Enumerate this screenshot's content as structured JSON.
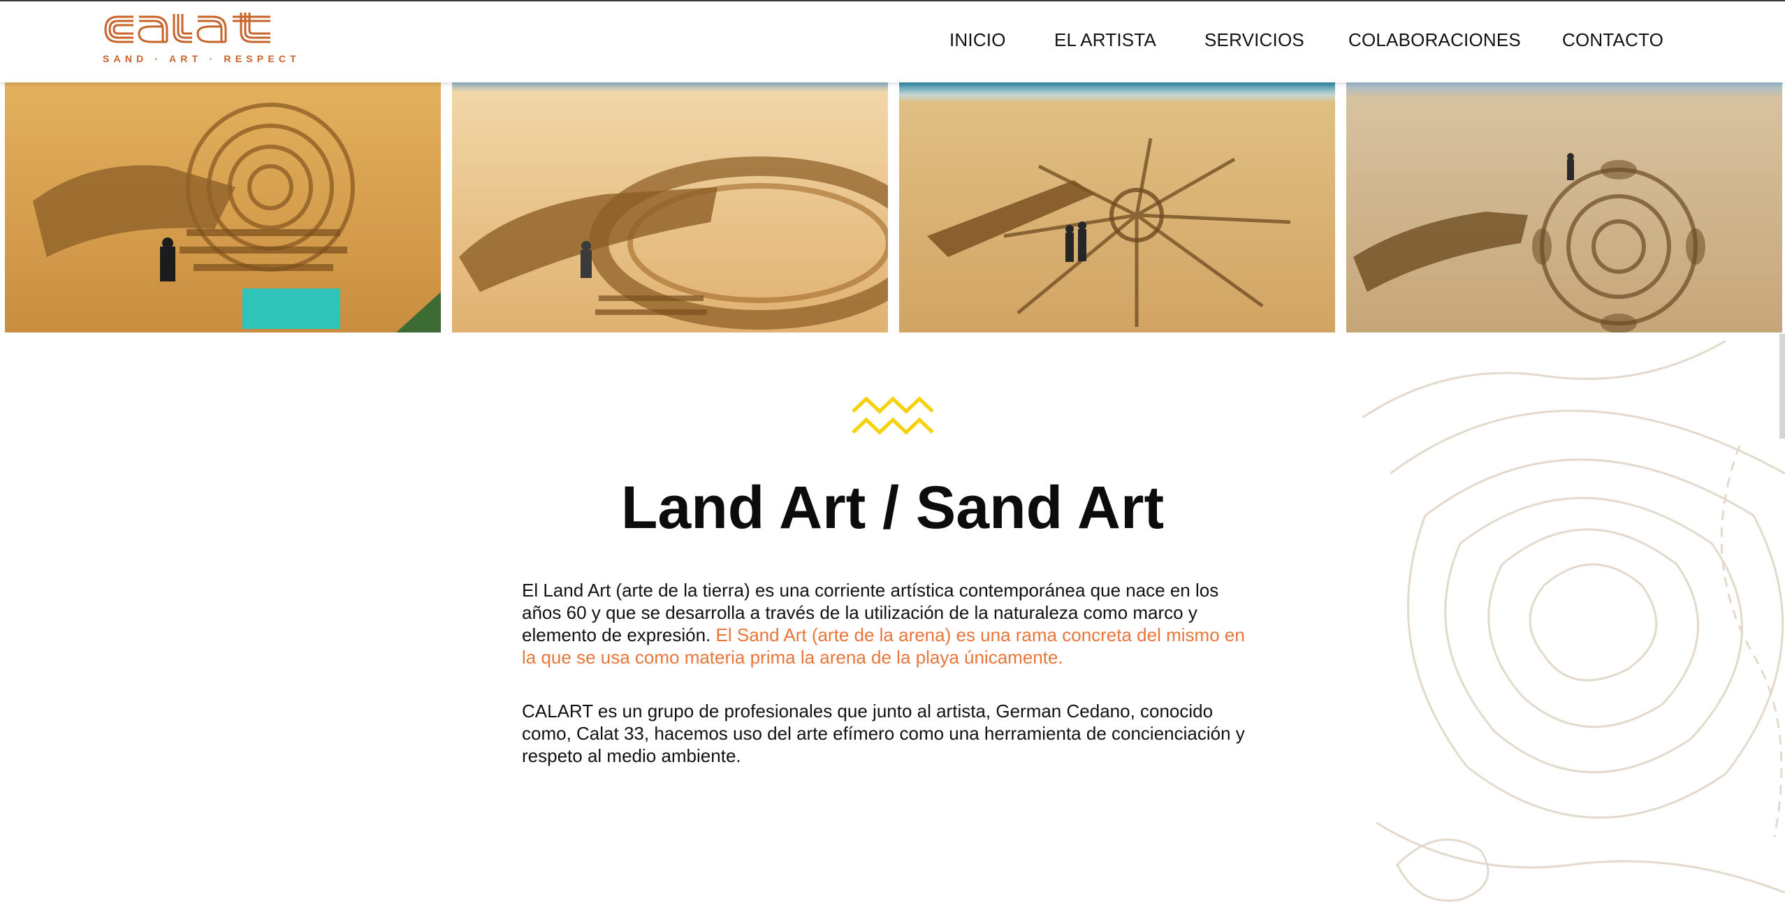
{
  "brand": {
    "logo_text": "calat",
    "tagline": "SAND · ART · RESPECT",
    "accent_color": "#c8632a"
  },
  "nav": {
    "items": [
      {
        "label": "INICIO"
      },
      {
        "label": "EL ARTISTA"
      },
      {
        "label": "SERVICIOS"
      },
      {
        "label": "COLABORACIONES"
      },
      {
        "label": "CONTACTO"
      }
    ]
  },
  "gallery": {
    "photos": [
      {
        "name": "sand-art-photo-avant"
      },
      {
        "name": "sand-art-photo-mandala-ring"
      },
      {
        "name": "sand-art-photo-basket"
      },
      {
        "name": "sand-art-photo-flower-mandala"
      }
    ]
  },
  "main": {
    "divider_icon": "zigzag-wave-icon",
    "divider_color": "#f5d20a",
    "title": "Land Art / Sand Art",
    "paragraph1_plain": "El Land Art (arte de la tierra) es una corriente artística contemporánea que nace en los años 60 y que se desarrolla a través de la utilización de la naturaleza como marco y elemento de expresión. ",
    "paragraph1_highlight": "El Sand Art (arte de la arena) es una rama concreta del mismo en la que se usa como materia prima la arena de la playa únicamente.",
    "paragraph1_highlight_color": "#e8763b",
    "paragraph2": "CALART es un grupo de profesionales que junto al artista, German Cedano, conocido como, Calat 33, hacemos uso del arte efímero como una herramienta de concienciación y respeto al medio ambiente."
  }
}
